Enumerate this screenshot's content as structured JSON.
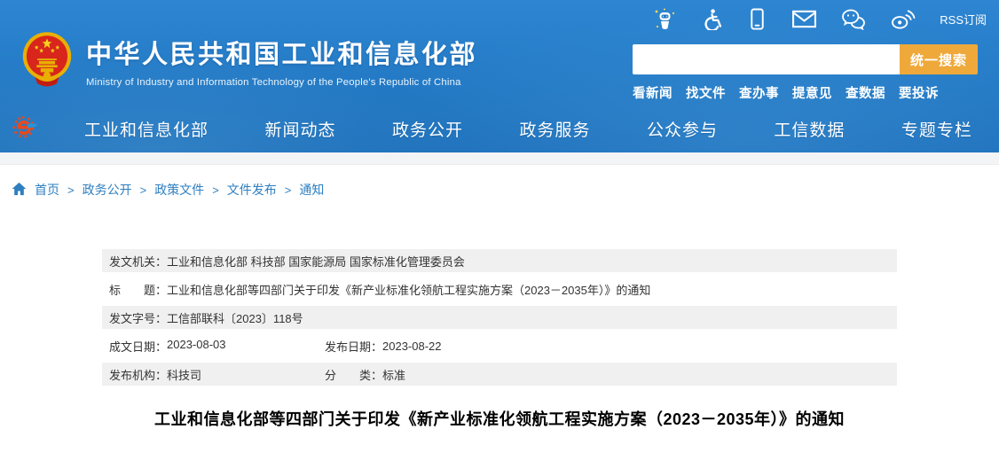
{
  "colors": {
    "header_blue": "#2379c4",
    "search_button_orange": "#efa93a",
    "link_blue": "#2e7fc0",
    "meta_row_gray": "#f0f0f0"
  },
  "utility_bar": {
    "icons": [
      "assistant-robot-icon",
      "accessibility-icon",
      "mobile-icon",
      "mail-icon",
      "wechat-icon",
      "weibo-icon"
    ],
    "rss_label": "RSS订阅"
  },
  "header": {
    "emblem": "china-national-emblem",
    "site_title": "中华人民共和国工业和信息化部",
    "site_subtitle": "Ministry of Industry and Information Technology of the People's Republic of China",
    "search": {
      "value": "",
      "placeholder": "",
      "button_label": "统一搜索"
    },
    "quick_links": [
      "看新闻",
      "找文件",
      "查办事",
      "提意见",
      "查数据",
      "要投诉"
    ]
  },
  "nav": {
    "logo": "miit-e-logo",
    "items": [
      "工业和信息化部",
      "新闻动态",
      "政务公开",
      "政务服务",
      "公众参与",
      "工信数据",
      "专题专栏"
    ]
  },
  "breadcrumb": {
    "separator": ">",
    "items": [
      "首页",
      "政务公开",
      "政策文件",
      "文件发布",
      "通知"
    ]
  },
  "doc_meta": {
    "rows": [
      {
        "label": "发文机关：",
        "value": "工业和信息化部 科技部 国家能源局 国家标准化管理委员会"
      },
      {
        "label": "标　　题：",
        "value": "工业和信息化部等四部门关于印发《新产业标准化领航工程实施方案（2023－2035年）》的通知"
      },
      {
        "label": "发文字号：",
        "value": "工信部联科〔2023〕118号"
      },
      {
        "label": "成文日期：",
        "value": "2023-08-03",
        "label2": "发布日期：",
        "value2": "2023-08-22"
      },
      {
        "label": "发布机构：",
        "value": "科技司",
        "label2": "分　　类：",
        "value2": "标准"
      }
    ]
  },
  "article": {
    "title": "工业和信息化部等四部门关于印发《新产业标准化领航工程实施方案（2023－2035年）》的通知"
  }
}
